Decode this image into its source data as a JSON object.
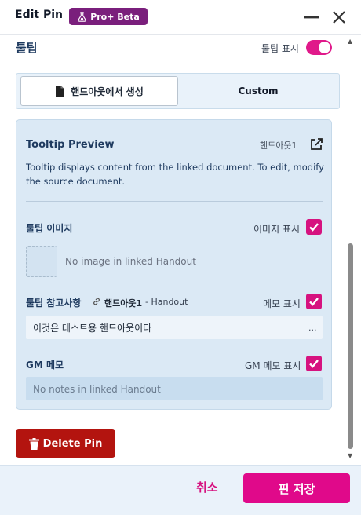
{
  "window": {
    "title": "Edit Pin",
    "badge": "Pro+ Beta"
  },
  "tooltip": {
    "section_title": "툴팁",
    "show_label": "툴팁 표시",
    "enabled": true,
    "source_tabs": [
      {
        "label": "핸드아웃에서 생성",
        "active": true
      },
      {
        "label": "Custom",
        "active": false
      }
    ],
    "preview": {
      "title": "Tooltip Preview",
      "source_name": "핸드아웃1",
      "description": "Tooltip displays content from the linked document. To edit, modify the source document."
    },
    "image": {
      "label": "툴팁 이미지",
      "show_label": "이미지 표시",
      "checked": true,
      "placeholder": "No image in linked Handout"
    },
    "notes": {
      "label": "툴팁 참고사항",
      "link_name": "핸드아웃1",
      "link_suffix": "- Handout",
      "show_label": "메모 표시",
      "checked": true,
      "text": "이것은 테스트용 핸드아웃이다",
      "overflow": "..."
    },
    "gm_notes": {
      "label": "GM 메모",
      "show_label": "GM 메모 표시",
      "checked": true,
      "placeholder": "No notes in linked Handout"
    }
  },
  "actions": {
    "delete": "Delete Pin",
    "cancel": "취소",
    "save": "핀 저장"
  },
  "colors": {
    "accent": "#e0098a",
    "danger": "#b3140f",
    "badge": "#7a1f7c",
    "heading": "#1e3a5f"
  }
}
